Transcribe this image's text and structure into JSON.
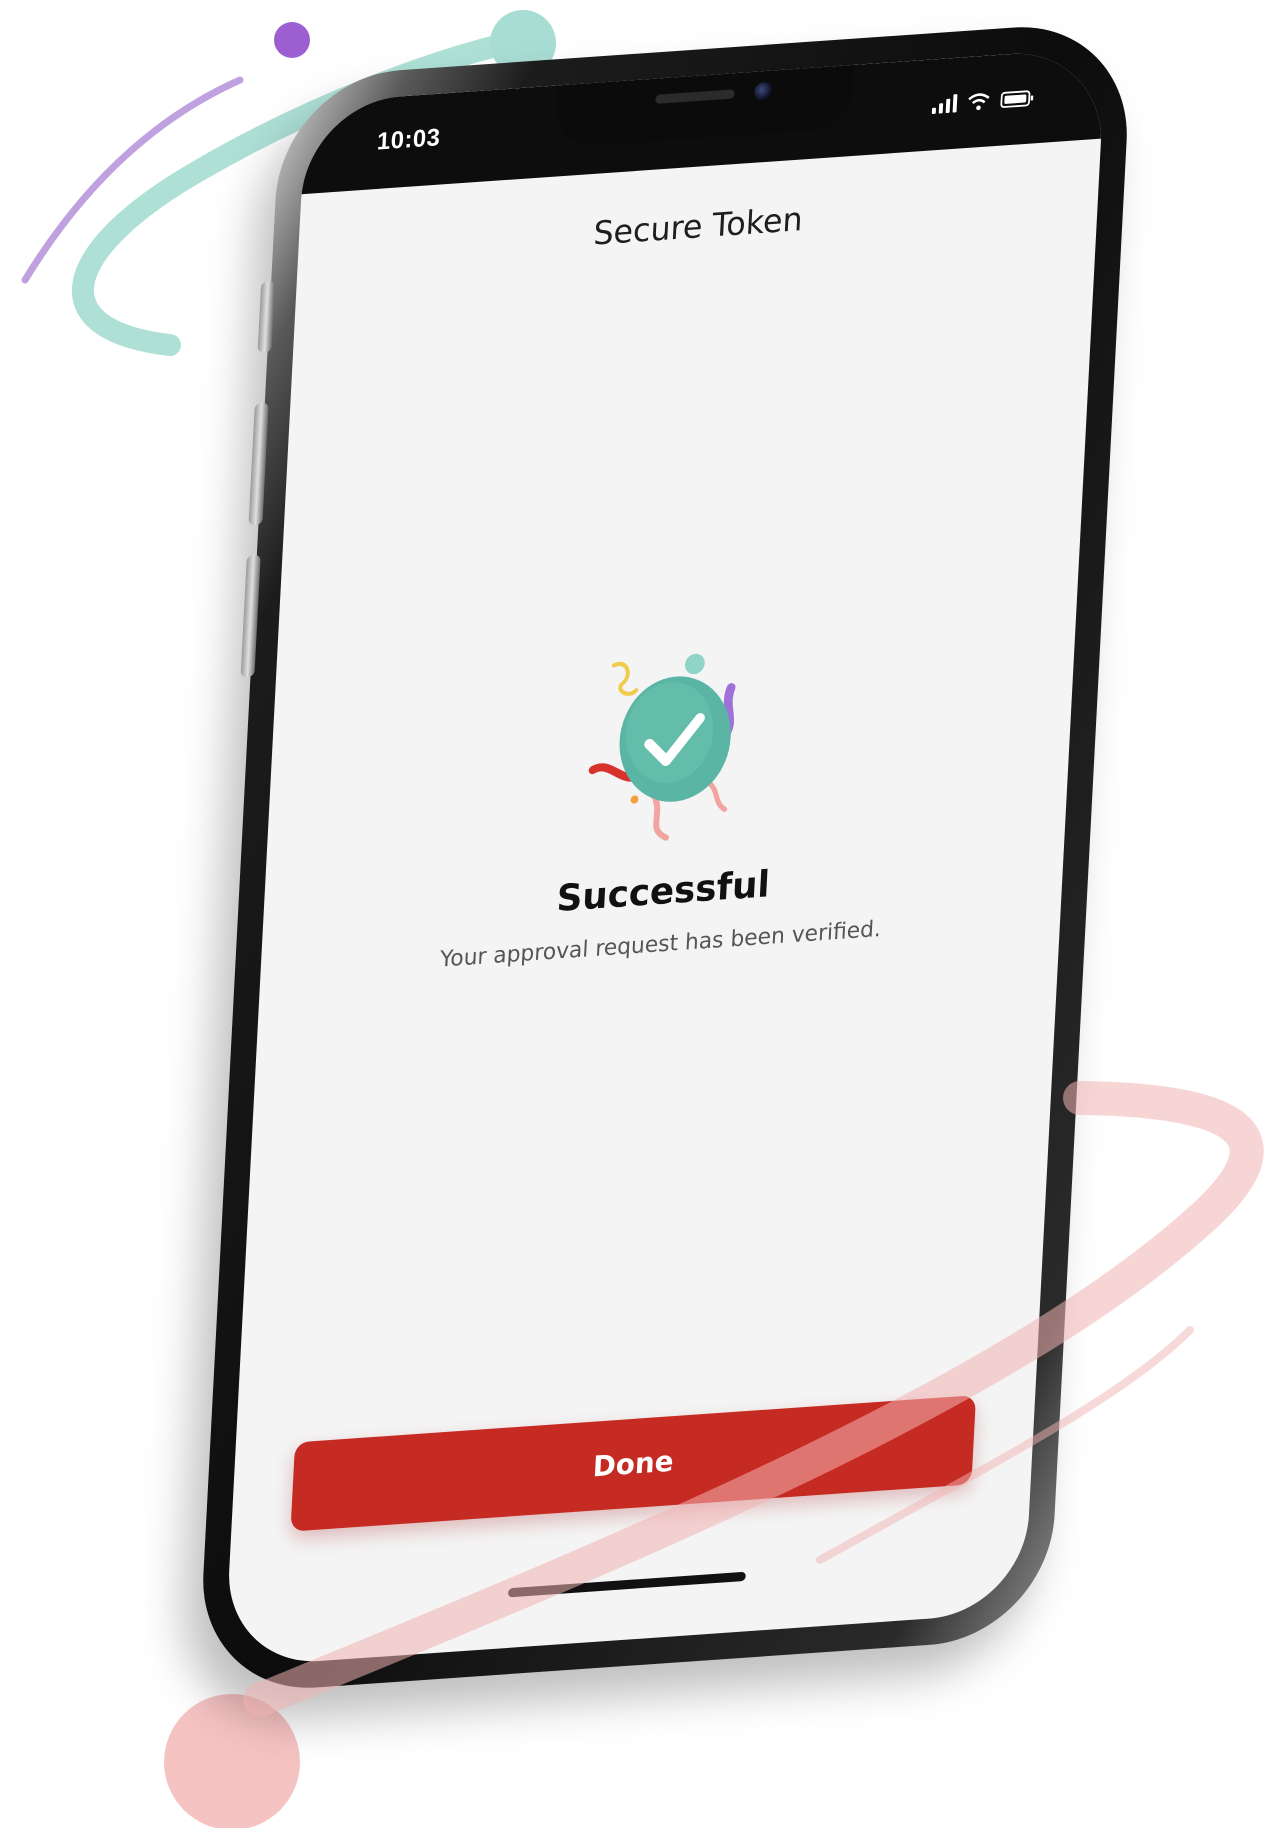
{
  "status_bar": {
    "time": "10:03",
    "icons": [
      "signal-icon",
      "wifi-icon",
      "battery-icon"
    ]
  },
  "app": {
    "title": "Secure Token"
  },
  "result": {
    "illustration": "success-checkmark-confetti-icon",
    "title": "Successful",
    "message": "Your approval request has been verified."
  },
  "actions": {
    "done_label": "Done"
  },
  "colors": {
    "primary_button": "#c62b23",
    "success_badge": "#5bb5a4",
    "decor_teal": "#7fcfc0",
    "decor_purple": "#9b6ad0",
    "decor_pink": "#f1a4a4"
  }
}
